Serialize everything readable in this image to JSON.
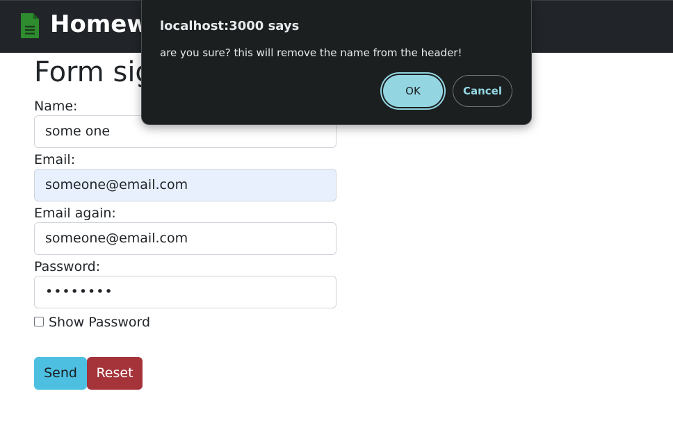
{
  "header": {
    "brand": "Homework"
  },
  "form": {
    "title": "Form sign up",
    "name_label": "Name:",
    "name_value": "some one",
    "email_label": "Email:",
    "email_value": "someone@email.com",
    "email_again_label": "Email again:",
    "email_again_value": "someone@email.com",
    "password_label": "Password:",
    "password_value": "••••••••",
    "show_password_label": "Show Password",
    "send_label": "Send",
    "reset_label": "Reset"
  },
  "dialog": {
    "title": "localhost:3000 says",
    "message": "are you sure? this will remove the name from the header!",
    "ok_label": "OK",
    "cancel_label": "Cancel"
  },
  "colors": {
    "navbar_bg": "#212529",
    "send_bg": "#4dc0e2",
    "reset_bg": "#a4343a",
    "dialog_bg": "#1b1f20",
    "dialog_accent": "#93d6e2",
    "autofill_bg": "#e8f0fe",
    "doc_icon": "#2e8b2e"
  },
  "icons": {
    "brand_icon": "document-icon"
  }
}
